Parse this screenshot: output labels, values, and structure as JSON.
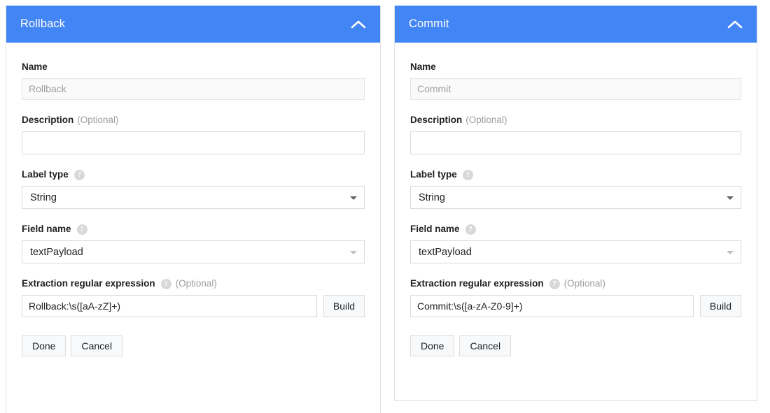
{
  "theme": {
    "header_bg": "#4285f4",
    "header_text": "#ffffff",
    "body_bg": "#ffffff",
    "border": "#e0e0e0",
    "label_text": "#212121",
    "muted_text": "#9e9e9e",
    "button_bg": "#f8f9fa"
  },
  "labels": {
    "name": "Name",
    "description": "Description",
    "optional": "(Optional)",
    "label_type": "Label type",
    "field_name": "Field name",
    "extraction_regex": "Extraction regular expression",
    "help_glyph": "?",
    "build": "Build",
    "done": "Done",
    "cancel": "Cancel"
  },
  "icons": {
    "collapse": "chevron-up-icon",
    "help": "help-circle-icon",
    "dropdown": "caret-down-icon"
  },
  "panels": [
    {
      "id": "rollback",
      "title": "Rollback",
      "name_value": "Rollback",
      "description_value": "",
      "description_placeholder": "",
      "label_type_value": "String",
      "field_name_value": "textPayload",
      "regex_value": "Rollback:\\s([aA-zZ]+)"
    },
    {
      "id": "commit",
      "title": "Commit",
      "name_value": "Commit",
      "description_value": "",
      "description_placeholder": "",
      "label_type_value": "String",
      "field_name_value": "textPayload",
      "regex_value": "Commit:\\s([a-zA-Z0-9]+)"
    }
  ]
}
